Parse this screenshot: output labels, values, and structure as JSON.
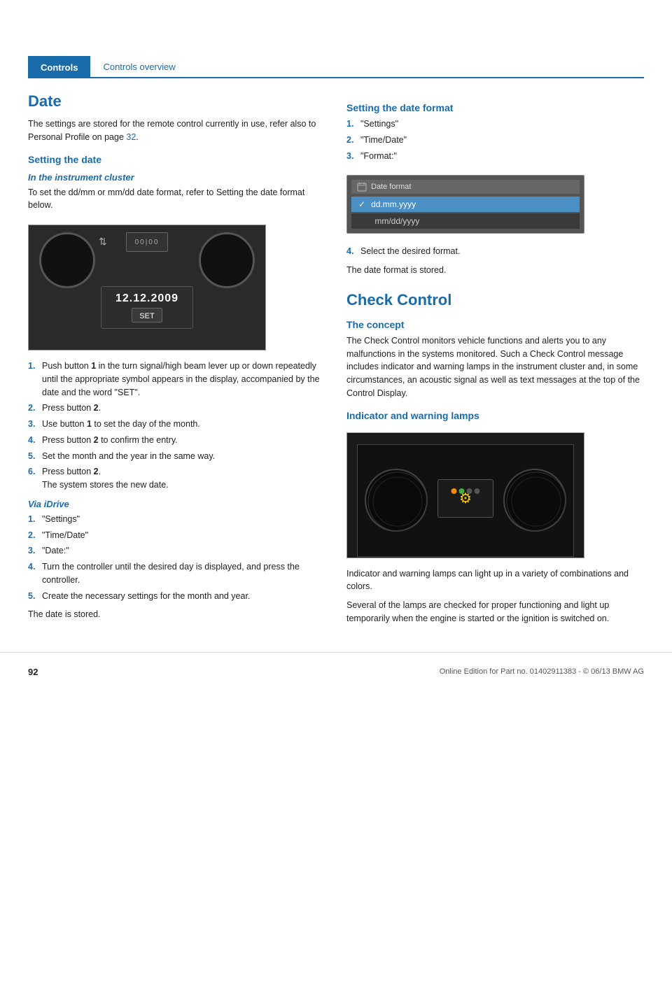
{
  "header": {
    "controls_label": "Controls",
    "section_label": "Controls overview"
  },
  "left": {
    "title": "Date",
    "intro": "The settings are stored for the remote control currently in use, refer also to Personal Profile on page",
    "intro_link": "32",
    "intro_end": ".",
    "setting_date_title": "Setting the date",
    "instrument_cluster_title": "In the instrument cluster",
    "instrument_cluster_text": "To set the dd/mm or mm/dd date format, refer to Setting the date format below.",
    "instrument_date": "12.12.2009",
    "instrument_set": "SET",
    "steps_left": [
      {
        "num": "1.",
        "text": "Push button ",
        "bold": "1",
        "rest": " in the turn signal/high beam lever up or down repeatedly until the appropriate symbol appears in the display, accompanied by the date and the word \"SET\"."
      },
      {
        "num": "2.",
        "text": "Press button ",
        "bold": "2",
        "rest": "."
      },
      {
        "num": "3.",
        "text": "Use button ",
        "bold": "1",
        "rest": " to set the day of the month."
      },
      {
        "num": "4.",
        "text": "Press button ",
        "bold": "2",
        "rest": " to confirm the entry."
      },
      {
        "num": "5.",
        "text": "Set the month and the year in the same way."
      },
      {
        "num": "6.",
        "text": "Press button ",
        "bold": "2",
        "rest": ".\nThe system stores the new date."
      }
    ],
    "via_idrive_title": "Via iDrive",
    "via_idrive_steps": [
      {
        "num": "1.",
        "text": "\"Settings\""
      },
      {
        "num": "2.",
        "text": "\"Time/Date\""
      },
      {
        "num": "3.",
        "text": "\"Date:\""
      },
      {
        "num": "4.",
        "text": "Turn the controller until the desired day is displayed, and press the controller."
      },
      {
        "num": "5.",
        "text": "Create the necessary settings for the month and year."
      }
    ],
    "date_stored": "The date is stored."
  },
  "right": {
    "setting_format_title": "Setting the date format",
    "format_steps": [
      {
        "num": "1.",
        "text": "\"Settings\""
      },
      {
        "num": "2.",
        "text": "\"Time/Date\""
      },
      {
        "num": "3.",
        "text": "\"Format:\""
      }
    ],
    "date_format_header": "Date format",
    "format_option1": "dd.mm.yyyy",
    "format_option2": "mm/dd/yyyy",
    "step4_text": "Select the desired format.",
    "format_stored": "The date format is stored.",
    "check_control_title": "Check Control",
    "concept_title": "The concept",
    "concept_text": "The Check Control monitors vehicle functions and alerts you to any malfunctions in the systems monitored. Such a Check Control message includes indicator and warning lamps in the instrument cluster and, in some circumstances, an acoustic signal as well as text messages at the top of the Control Display.",
    "indicator_title": "Indicator and warning lamps",
    "indicator_text1": "Indicator and warning lamps can light up in a variety of combinations and colors.",
    "indicator_text2": "Several of the lamps are checked for proper functioning and light up temporarily when the engine is started or the ignition is switched on."
  },
  "footer": {
    "page_number": "92",
    "footer_text": "Online Edition for Part no. 01402911383 - © 06/13 BMW AG"
  }
}
